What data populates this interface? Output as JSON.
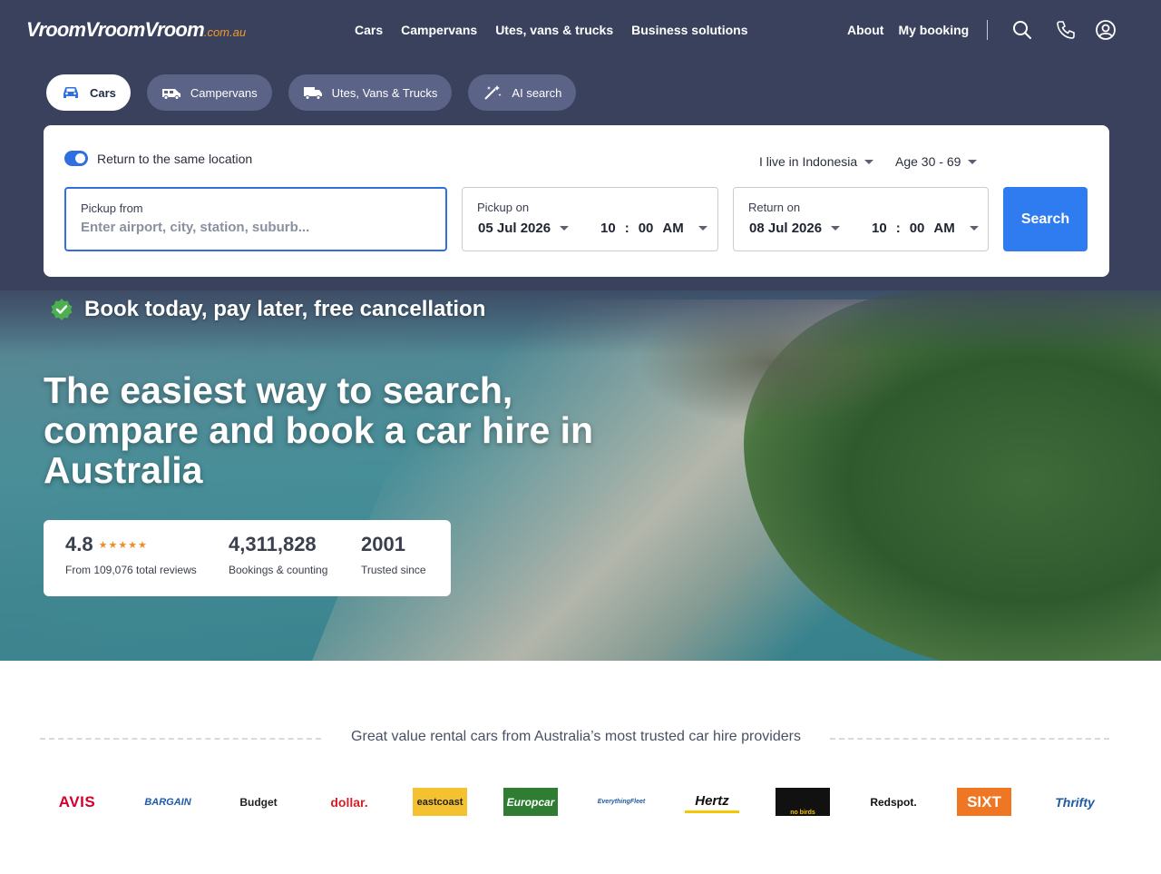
{
  "nav": {
    "logo_main": "VroomVroomVroom",
    "logo_suffix": ".com.au",
    "links": [
      "Cars",
      "Campervans",
      "Utes, vans & trucks",
      "Business solutions"
    ],
    "about": "About",
    "my_booking": "My booking"
  },
  "tabs": [
    {
      "label": "Cars",
      "icon": "car-icon",
      "active": true
    },
    {
      "label": "Campervans",
      "icon": "campervan-icon",
      "active": false
    },
    {
      "label": "Utes, Vans & Trucks",
      "icon": "truck-icon",
      "active": false
    },
    {
      "label": "AI search",
      "icon": "magic-wand-icon",
      "active": false
    }
  ],
  "search": {
    "return_same_location": "Return to the same location",
    "residence": "I live in Indonesia",
    "age": "Age 30 - 69",
    "pickup_from_label": "Pickup from",
    "pickup_from_placeholder": "Enter airport, city, station, suburb...",
    "pickup_on_label": "Pickup on",
    "pickup_date": "05 Jul 2026",
    "pickup_hour": "10",
    "pickup_minute": "00",
    "pickup_ampm": "AM",
    "return_on_label": "Return on",
    "return_date": "08 Jul 2026",
    "return_hour": "10",
    "return_minute": "00",
    "return_ampm": "AM",
    "search_button": "Search"
  },
  "hero": {
    "promo": "Book today, pay later, free cancellation",
    "headline": "The easiest way to search, compare and book a car hire in Australia",
    "rating": "4.8",
    "stars": "★★★★★",
    "rating_label": "From 109,076 total reviews",
    "bookings": "4,311,828",
    "bookings_label": "Bookings & counting",
    "since": "2001",
    "since_label": "Trusted since"
  },
  "providers": {
    "title": "Great value rental cars from Australia’s most trusted car hire providers",
    "logos": [
      "AVIS",
      "BARGAIN",
      "Budget",
      "dollar.",
      "eastcoast",
      "Europcar",
      "EverythingFleet",
      "Hertz",
      "no birds",
      "Redspot.",
      "SIXT",
      "Thrifty"
    ]
  },
  "colors": {
    "header_bg": "#3a415d",
    "accent": "#2f7bf0",
    "promo_check": "#4caf50"
  }
}
